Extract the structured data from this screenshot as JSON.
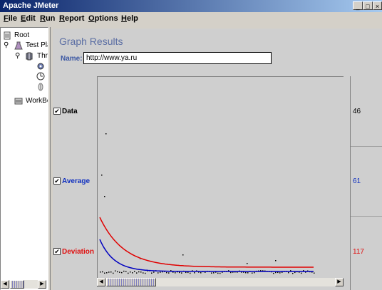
{
  "window": {
    "title": "Apache JMeter",
    "controls": [
      "minimize-icon",
      "maximize-icon",
      "close-icon"
    ]
  },
  "menu": {
    "items": [
      {
        "label": "File",
        "mnemonic": "F",
        "rest": "ile"
      },
      {
        "label": "Edit",
        "mnemonic": "E",
        "rest": "dit"
      },
      {
        "label": "Run",
        "mnemonic": "R",
        "rest": "un"
      },
      {
        "label": "Report",
        "mnemonic": "R",
        "rest": "eport"
      },
      {
        "label": "Options",
        "mnemonic": "O",
        "rest": "ptions"
      },
      {
        "label": "Help",
        "mnemonic": "H",
        "rest": "elp"
      }
    ]
  },
  "tree": {
    "items": [
      {
        "label": "Root",
        "icon": "document-icon"
      },
      {
        "label": "Test Pla",
        "icon": "flask-icon"
      },
      {
        "label": "Thr",
        "icon": "spool-icon"
      },
      {
        "label": "",
        "icon": "gear-icon"
      },
      {
        "label": "",
        "icon": "timer-icon"
      },
      {
        "label": "",
        "icon": "listener-icon"
      },
      {
        "label": "WorkBe",
        "icon": "workbench-icon"
      }
    ]
  },
  "panel": {
    "title": "Graph Results",
    "name_label": "Name:",
    "name_value": "http://www.ya.ru"
  },
  "legend": [
    {
      "label": "Data",
      "checked": true,
      "color": "#000000",
      "value": "46"
    },
    {
      "label": "Average",
      "checked": true,
      "color": "#0000c0",
      "value": "61"
    },
    {
      "label": "Deviation",
      "checked": true,
      "color": "#e00000",
      "value": "117"
    }
  ],
  "chart_data": {
    "type": "scatter",
    "series": [
      {
        "name": "Data",
        "color": "#000000"
      },
      {
        "name": "Average",
        "color": "#0000c0"
      },
      {
        "name": "Deviation",
        "color": "#e00000"
      }
    ]
  }
}
